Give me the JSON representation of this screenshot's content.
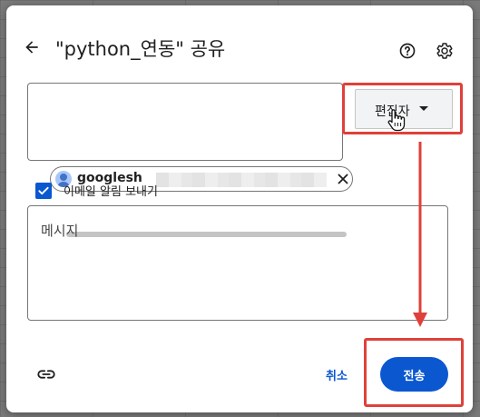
{
  "dialog": {
    "title": "\"python_연동\" 공유"
  },
  "header": {
    "back_icon": "arrow-back-icon",
    "help_icon": "help-circle-icon",
    "settings_icon": "gear-icon"
  },
  "recipients": {
    "chip_label": "googlesh",
    "chip_icon": "person-avatar-icon",
    "chip_close_icon": "close-icon"
  },
  "role": {
    "label": "편집자",
    "caret_icon": "caret-down-icon"
  },
  "notify": {
    "checked": true,
    "label": "이메일 알림 보내기"
  },
  "message": {
    "placeholder": "메시지"
  },
  "footer": {
    "link_icon": "link-icon",
    "cancel_label": "취소",
    "send_label": "전송"
  },
  "colors": {
    "accent": "#0b57d0",
    "annotation": "#e0403a",
    "overlay": "#7a7a7a"
  }
}
